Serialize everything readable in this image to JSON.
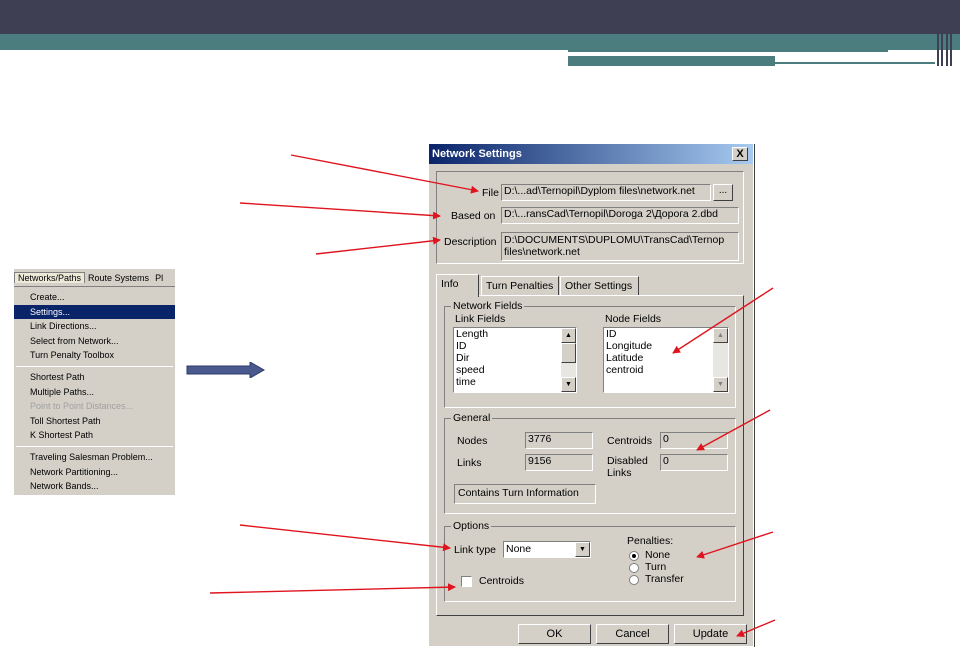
{
  "menu": {
    "menubar": [
      "Networks/Paths",
      "Route Systems",
      "Pl"
    ],
    "items": [
      {
        "label": "Create...",
        "state": "normal"
      },
      {
        "label": "Settings...",
        "state": "selected"
      },
      {
        "label": "Link Directions...",
        "state": "normal"
      },
      {
        "label": "Select from Network...",
        "state": "normal"
      },
      {
        "label": "Turn Penalty Toolbox",
        "state": "normal"
      },
      {
        "label": "Shortest Path",
        "state": "normal"
      },
      {
        "label": "Multiple Paths...",
        "state": "normal"
      },
      {
        "label": "Point to Point Distances...",
        "state": "disabled"
      },
      {
        "label": "Toll Shortest Path",
        "state": "normal"
      },
      {
        "label": "K Shortest Path",
        "state": "normal"
      },
      {
        "label": "Traveling Salesman Problem...",
        "state": "normal"
      },
      {
        "label": "Network Partitioning...",
        "state": "normal"
      },
      {
        "label": "Network Bands...",
        "state": "normal"
      }
    ]
  },
  "dialog": {
    "title": "Network Settings",
    "close_label": "X",
    "file_label": "File",
    "file_value": "D:\\...ad\\Ternopil\\Dyplom files\\network.net",
    "browse_label": "...",
    "based_on_label": "Based on",
    "based_on_value": "D:\\...ransCad\\Ternopil\\Doroga 2\\Дорога 2.dbd",
    "description_label": "Description",
    "description_line1": "D:\\DOCUMENTS\\DUPLOMU\\TransCad\\Ternop",
    "description_line2": "files\\network.net",
    "tabs": [
      "Info",
      "Turn Penalties",
      "Other Settings"
    ],
    "network_fields_title": "Network Fields",
    "link_fields_label": "Link Fields",
    "node_fields_label": "Node Fields",
    "link_fields": [
      "Length",
      "ID",
      "Dir",
      "speed",
      "time"
    ],
    "node_fields": [
      "ID",
      "Longitude",
      "Latitude",
      "centroid"
    ],
    "general_title": "General",
    "nodes_label": "Nodes",
    "nodes_value": "3776",
    "links_label": "Links",
    "links_value": "9156",
    "centroids_label": "Centroids",
    "centroids_value": "0",
    "disabled_label_1": "Disabled",
    "disabled_label_2": "Links",
    "disabled_value": "0",
    "turn_info_label": "Contains Turn Information",
    "options_title": "Options",
    "link_type_label": "Link type",
    "link_type_value": "None",
    "centroids_check_label": "Centroids",
    "penalties_label": "Penalties:",
    "penalty_options": [
      "None",
      "Turn",
      "Transfer"
    ],
    "penalty_selected": "None",
    "ok_label": "OK",
    "cancel_label": "Cancel",
    "update_label": "Update"
  },
  "colors": {
    "topbar": "#3f3f54",
    "teal": "#4c7d7e",
    "annotation_red": "#e0141e",
    "big_arrow": "#4a5a8e",
    "title_start": "#0a246a",
    "title_end": "#a6caf0"
  }
}
